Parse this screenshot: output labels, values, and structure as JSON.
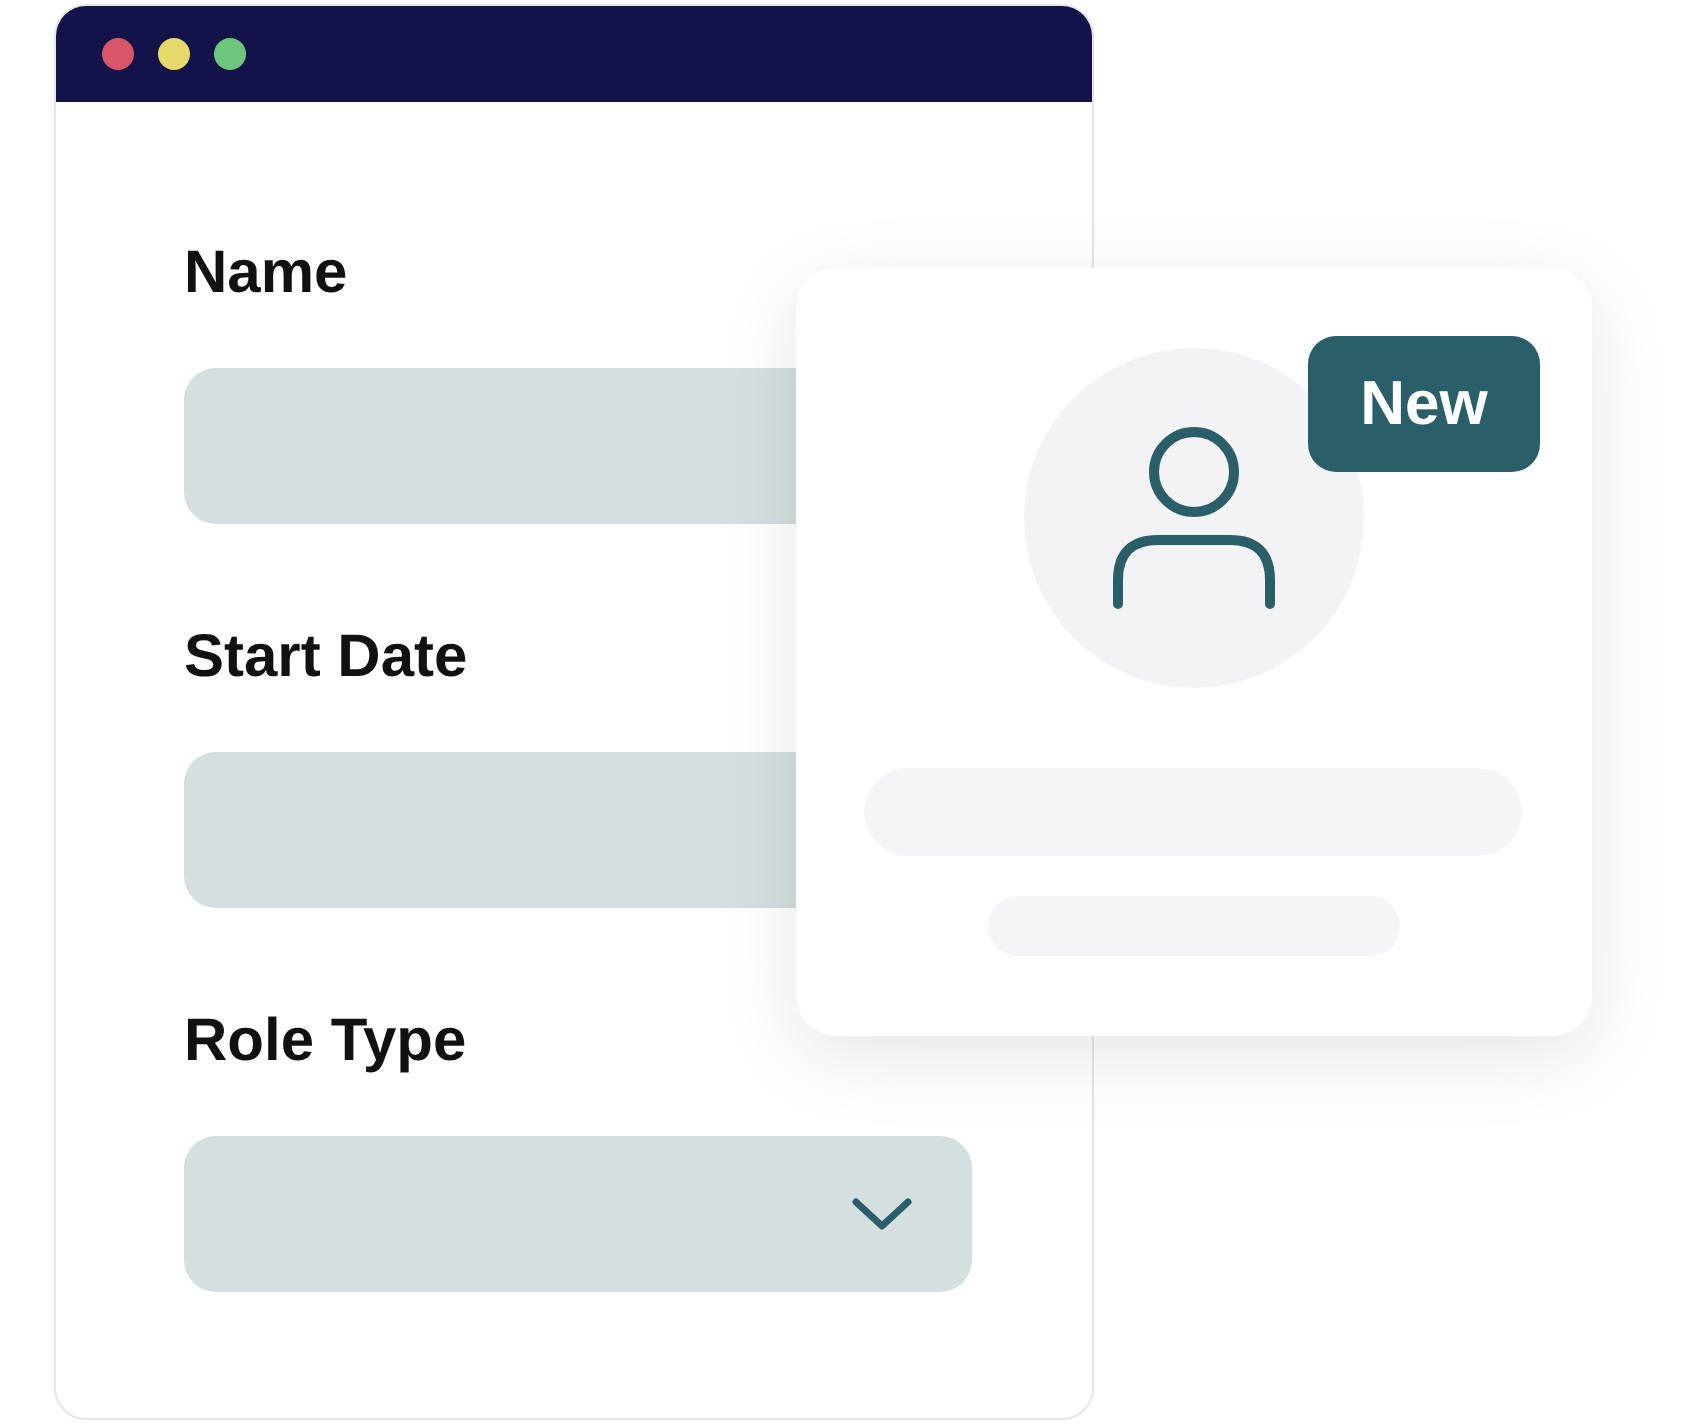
{
  "fields": [
    {
      "label": "Name",
      "kind": "text"
    },
    {
      "label": "Start Date",
      "kind": "text"
    },
    {
      "label": "Role Type",
      "kind": "select"
    }
  ],
  "profile_card": {
    "badge": "New"
  }
}
